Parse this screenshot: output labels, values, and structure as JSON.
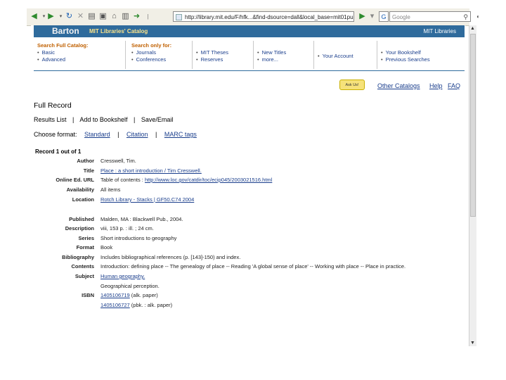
{
  "browser": {
    "url": "http://library.mit.edu/F/hfk...&find-dsource=dall&local_base=mit01pub&...",
    "search_placeholder": "Google",
    "icons": [
      "back-icon",
      "forward-icon",
      "reload-icon",
      "stop-icon",
      "home-icon",
      "bookmarks-icon",
      "history-icon",
      "go-icon",
      "search-icon"
    ]
  },
  "banner": {
    "logo": "Barton",
    "tagline": "MIT Libraries' Catalog",
    "right": "MIT Libraries"
  },
  "nav": {
    "full_catalog_heading": "Search Full Catalog:",
    "full_catalog_items": [
      "Basic",
      "Advanced"
    ],
    "search_only_heading": "Search only for:",
    "col1": [
      "Journals",
      "Conferences"
    ],
    "col2": [
      "MIT Theses",
      "Reserves"
    ],
    "col3": [
      "New Titles",
      "more..."
    ],
    "account": "Your Account",
    "col5": [
      "Your Bookshelf",
      "Previous Searches"
    ]
  },
  "toplinks": {
    "ask_us": "Ask Us!",
    "other_catalogs": "Other Catalogs",
    "help": "Help",
    "faq": "FAQ"
  },
  "page_title": "Full Record",
  "actions": {
    "results_list": "Results List",
    "add_to_bookshelf": "Add to Bookshelf",
    "save_email": "Save/Email",
    "sep": "|"
  },
  "format": {
    "label": "Choose format:",
    "standard": "Standard",
    "citation": "Citation",
    "marc": "MARC tags"
  },
  "record_counter": "Record 1 out of 1",
  "record": [
    {
      "label": "Author",
      "value": "Cresswell, Tim.",
      "link": false
    },
    {
      "label": "Title",
      "value": "Place : a short introduction / Tim Cresswell.",
      "link": true
    },
    {
      "label": "Online Ed. URL",
      "prefix": "Table of contents : ",
      "value": "http://www.loc.gov/catdir/toc/ecip045/2003021516.html",
      "link": true
    },
    {
      "label": "Availability",
      "value": "All items",
      "link": false
    },
    {
      "label": "Location",
      "value": "Rotch Library - Stacks | GF50.C74 2004",
      "link": true
    },
    {
      "label": "Published",
      "value": "Malden, MA : Blackwell Pub., 2004.",
      "link": false
    },
    {
      "label": "Description",
      "value": "viii, 153 p. : ill. ; 24 cm.",
      "link": false
    },
    {
      "label": "Series",
      "value": "Short introductions to geography",
      "link": false
    },
    {
      "label": "Format",
      "value": "Book",
      "link": false
    },
    {
      "label": "Bibliography",
      "value": "Includes bibliographical references (p. [143]-150) and index.",
      "link": false
    },
    {
      "label": "Contents",
      "value": "Introduction: defining place -- The genealogy of place -- Reading 'A global sense of place' -- Working with place -- Place in practice.",
      "link": false
    },
    {
      "label": "Subject",
      "value": "Human geography.",
      "link": true
    },
    {
      "label": "",
      "value": "Geographical perception.",
      "link": false
    },
    {
      "label": "ISBN",
      "value": "1405106719",
      "suffix": " (alk. paper)",
      "link": true
    },
    {
      "label": "",
      "value": "1405106727",
      "suffix": " (pbk. : alk. paper)",
      "link": true
    }
  ]
}
